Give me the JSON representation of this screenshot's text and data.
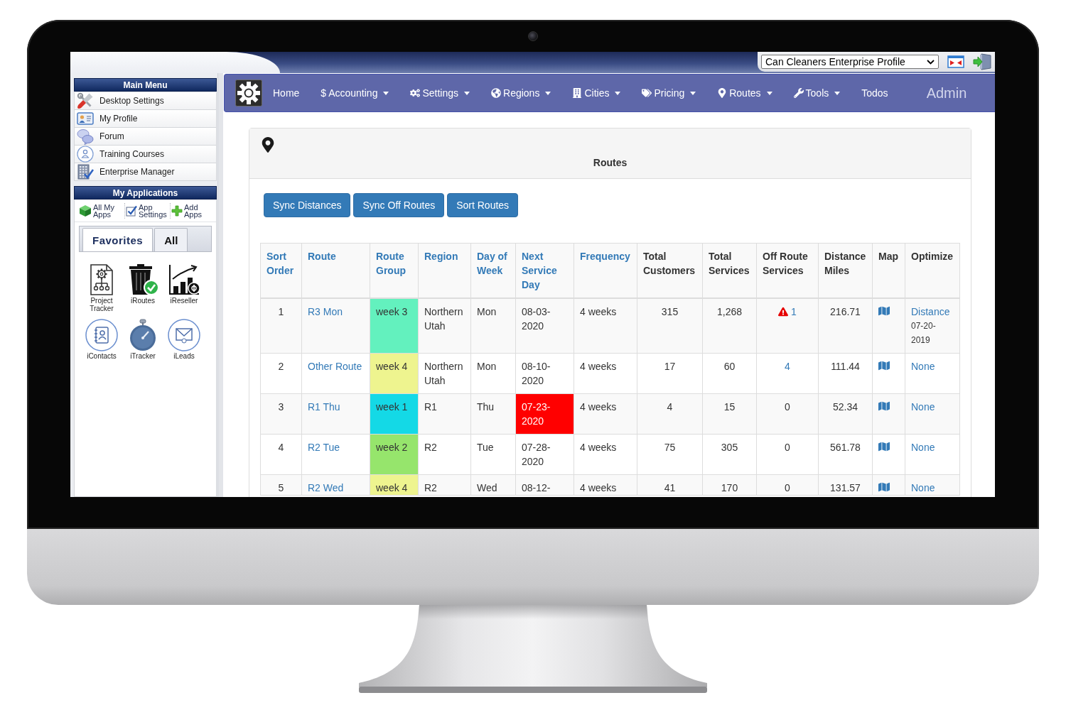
{
  "header": {
    "profile_select": {
      "value": "Can Cleaners Enterprise Profile"
    }
  },
  "sidebar": {
    "main_menu": {
      "title": "Main Menu",
      "items": [
        "Desktop Settings",
        "My Profile",
        "Forum",
        "Training Courses",
        "Enterprise Manager"
      ]
    },
    "my_applications": {
      "title": "My Applications",
      "actions": [
        "All My Apps",
        "App Settings",
        "Add Apps"
      ],
      "tabs": [
        {
          "label": "Favorites",
          "selected": true
        },
        {
          "label": "All",
          "selected": false
        }
      ],
      "apps": [
        "Project Tracker",
        "iRoutes",
        "iReseller",
        "iContacts",
        "iTracker",
        "iLeads"
      ]
    }
  },
  "nav": {
    "items": [
      {
        "label": "Home",
        "dropdown": false
      },
      {
        "label": "Accounting",
        "symbol": "$",
        "dropdown": true
      },
      {
        "label": "Settings",
        "dropdown": true
      },
      {
        "label": "Regions",
        "dropdown": true
      },
      {
        "label": "Cities",
        "dropdown": true
      },
      {
        "label": "Pricing",
        "dropdown": true
      },
      {
        "label": "Routes",
        "dropdown": true
      },
      {
        "label": "Tools",
        "dropdown": true
      },
      {
        "label": "Todos",
        "dropdown": false
      }
    ],
    "user": "Admin"
  },
  "panel": {
    "title": "Routes",
    "buttons": [
      "Sync Distances",
      "Sync Off Routes",
      "Sort Routes"
    ],
    "table": {
      "columns": [
        {
          "label": "Sort Order",
          "sortable": true
        },
        {
          "label": "Route",
          "sortable": true
        },
        {
          "label": "Route Group",
          "sortable": true
        },
        {
          "label": "Region",
          "sortable": true
        },
        {
          "label": "Day of Week",
          "sortable": true
        },
        {
          "label": "Next Service Day",
          "sortable": true
        },
        {
          "label": "Frequency",
          "sortable": true
        },
        {
          "label": "Total Customers",
          "sortable": false
        },
        {
          "label": "Total Services",
          "sortable": false
        },
        {
          "label": "Off Route Services",
          "sortable": false
        },
        {
          "label": "Distance Miles",
          "sortable": false
        },
        {
          "label": "Map",
          "sortable": false
        },
        {
          "label": "Optimize",
          "sortable": false
        }
      ],
      "rows": [
        {
          "sort_order": "1",
          "route": "R3 Mon",
          "route_group": {
            "label": "week 3",
            "color": "#63f1be"
          },
          "region": "Northern Utah",
          "day_of_week": "Mon",
          "next_service_day": {
            "text": "08-03-2020",
            "overdue": false
          },
          "frequency": "4 weeks",
          "total_customers": "315",
          "total_services": "1,268",
          "off_route_services": {
            "text": "1",
            "warning": true,
            "link": true
          },
          "distance_miles": "216.71",
          "optimize": {
            "label": "Distance",
            "date": "07-20-2019"
          }
        },
        {
          "sort_order": "2",
          "route": "Other Route",
          "route_group": {
            "label": "week 4",
            "color": "#eef48f"
          },
          "region": "Northern Utah",
          "day_of_week": "Mon",
          "next_service_day": {
            "text": "08-10-2020",
            "overdue": false
          },
          "frequency": "4 weeks",
          "total_customers": "17",
          "total_services": "60",
          "off_route_services": {
            "text": "4",
            "warning": false,
            "link": true
          },
          "distance_miles": "111.44",
          "optimize": {
            "label": "None"
          }
        },
        {
          "sort_order": "3",
          "route": "R1 Thu",
          "route_group": {
            "label": "week 1",
            "color": "#14d9e6"
          },
          "region": "R1",
          "day_of_week": "Thu",
          "next_service_day": {
            "text": "07-23-2020",
            "overdue": true
          },
          "frequency": "4 weeks",
          "total_customers": "4",
          "total_services": "15",
          "off_route_services": {
            "text": "0",
            "warning": false,
            "link": false
          },
          "distance_miles": "52.34",
          "optimize": {
            "label": "None"
          }
        },
        {
          "sort_order": "4",
          "route": "R2 Tue",
          "route_group": {
            "label": "week 2",
            "color": "#96e56c"
          },
          "region": "R2",
          "day_of_week": "Tue",
          "next_service_day": {
            "text": "07-28-2020",
            "overdue": false
          },
          "frequency": "4 weeks",
          "total_customers": "75",
          "total_services": "305",
          "off_route_services": {
            "text": "0",
            "warning": false,
            "link": false
          },
          "distance_miles": "561.78",
          "optimize": {
            "label": "None"
          }
        },
        {
          "sort_order": "5",
          "route": "R2 Wed",
          "route_group": {
            "label": "week 4",
            "color": "#eef48f"
          },
          "region": "R2",
          "day_of_week": "Wed",
          "next_service_day": {
            "text": "08-12-",
            "overdue": false
          },
          "frequency": "4 weeks",
          "total_customers": "41",
          "total_services": "170",
          "off_route_services": {
            "text": "0",
            "warning": false,
            "link": false
          },
          "distance_miles": "131.57",
          "optimize": {
            "label": "None"
          }
        }
      ]
    }
  }
}
